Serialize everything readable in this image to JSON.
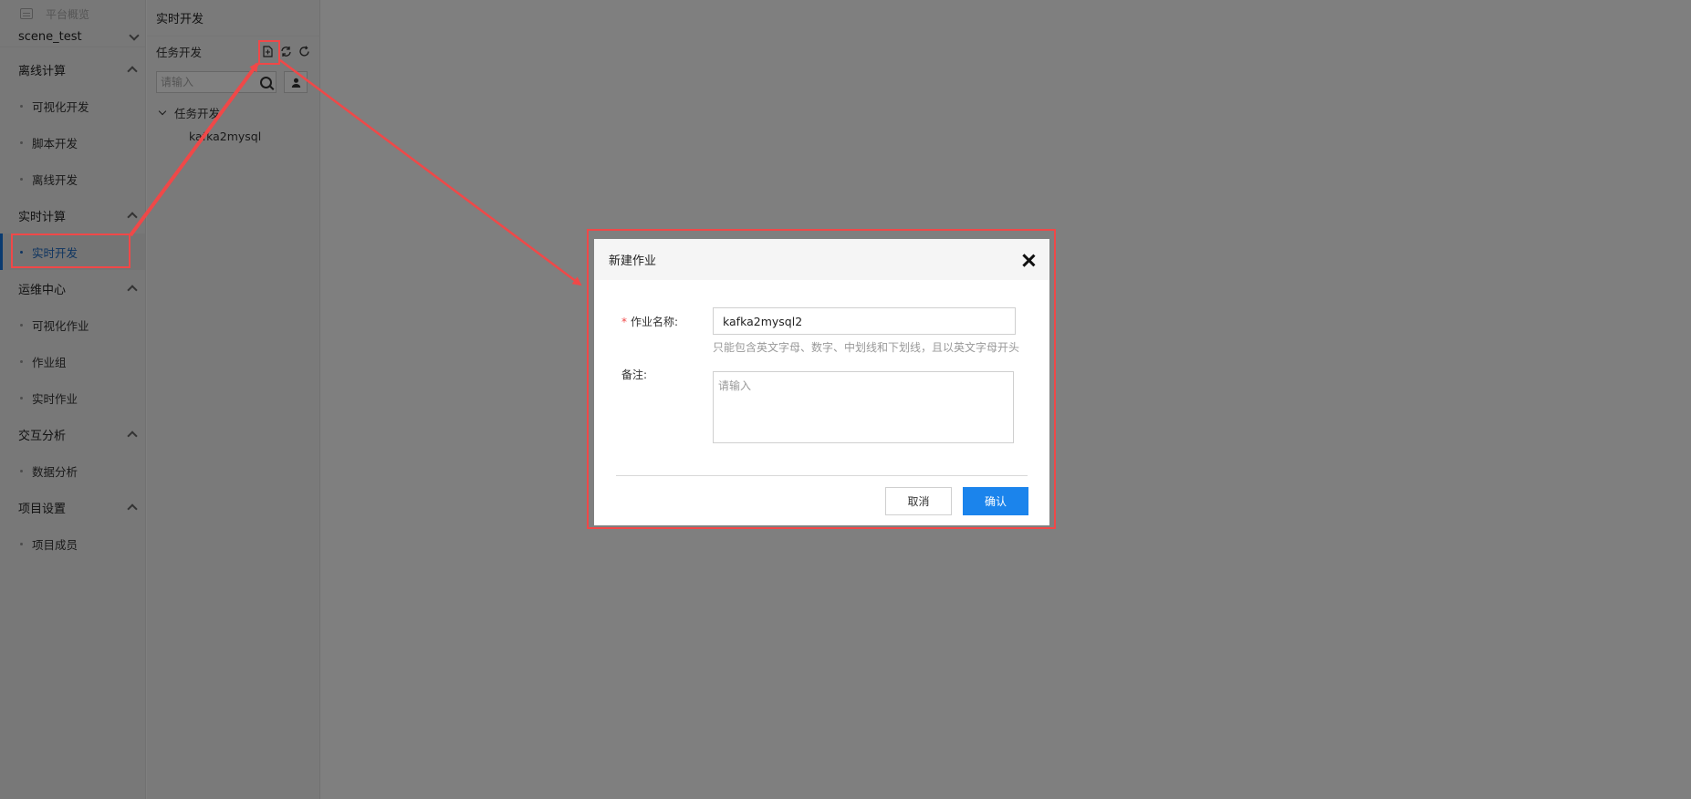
{
  "sidebar": {
    "overview_label": "平台概览",
    "project": "scene_test",
    "groups": [
      {
        "label": "离线计算",
        "items": [
          "可视化开发",
          "脚本开发",
          "离线开发"
        ]
      },
      {
        "label": "实时计算",
        "items": [
          "实时开发"
        ]
      },
      {
        "label": "运维中心",
        "items": [
          "可视化作业",
          "作业组",
          "实时作业"
        ]
      },
      {
        "label": "交互分析",
        "items": [
          "数据分析"
        ]
      },
      {
        "label": "项目设置",
        "items": [
          "项目成员"
        ]
      }
    ],
    "active_item": "实时开发"
  },
  "panel": {
    "title": "实时开发",
    "sub_title": "任务开发",
    "search_placeholder": "请输入",
    "tree_folder": "任务开发",
    "tree_leaf": "kafka2mysql"
  },
  "modal": {
    "title": "新建作业",
    "name_label": "作业名称:",
    "name_value": "kafka2mysql2",
    "name_hint": "只能包含英文字母、数字、中划线和下划线，且以英文字母开头",
    "note_label": "备注:",
    "note_placeholder": "请输入",
    "cancel_label": "取消",
    "confirm_label": "确认"
  },
  "colors": {
    "accent": "#1b84ec",
    "annotation": "#f04848"
  }
}
